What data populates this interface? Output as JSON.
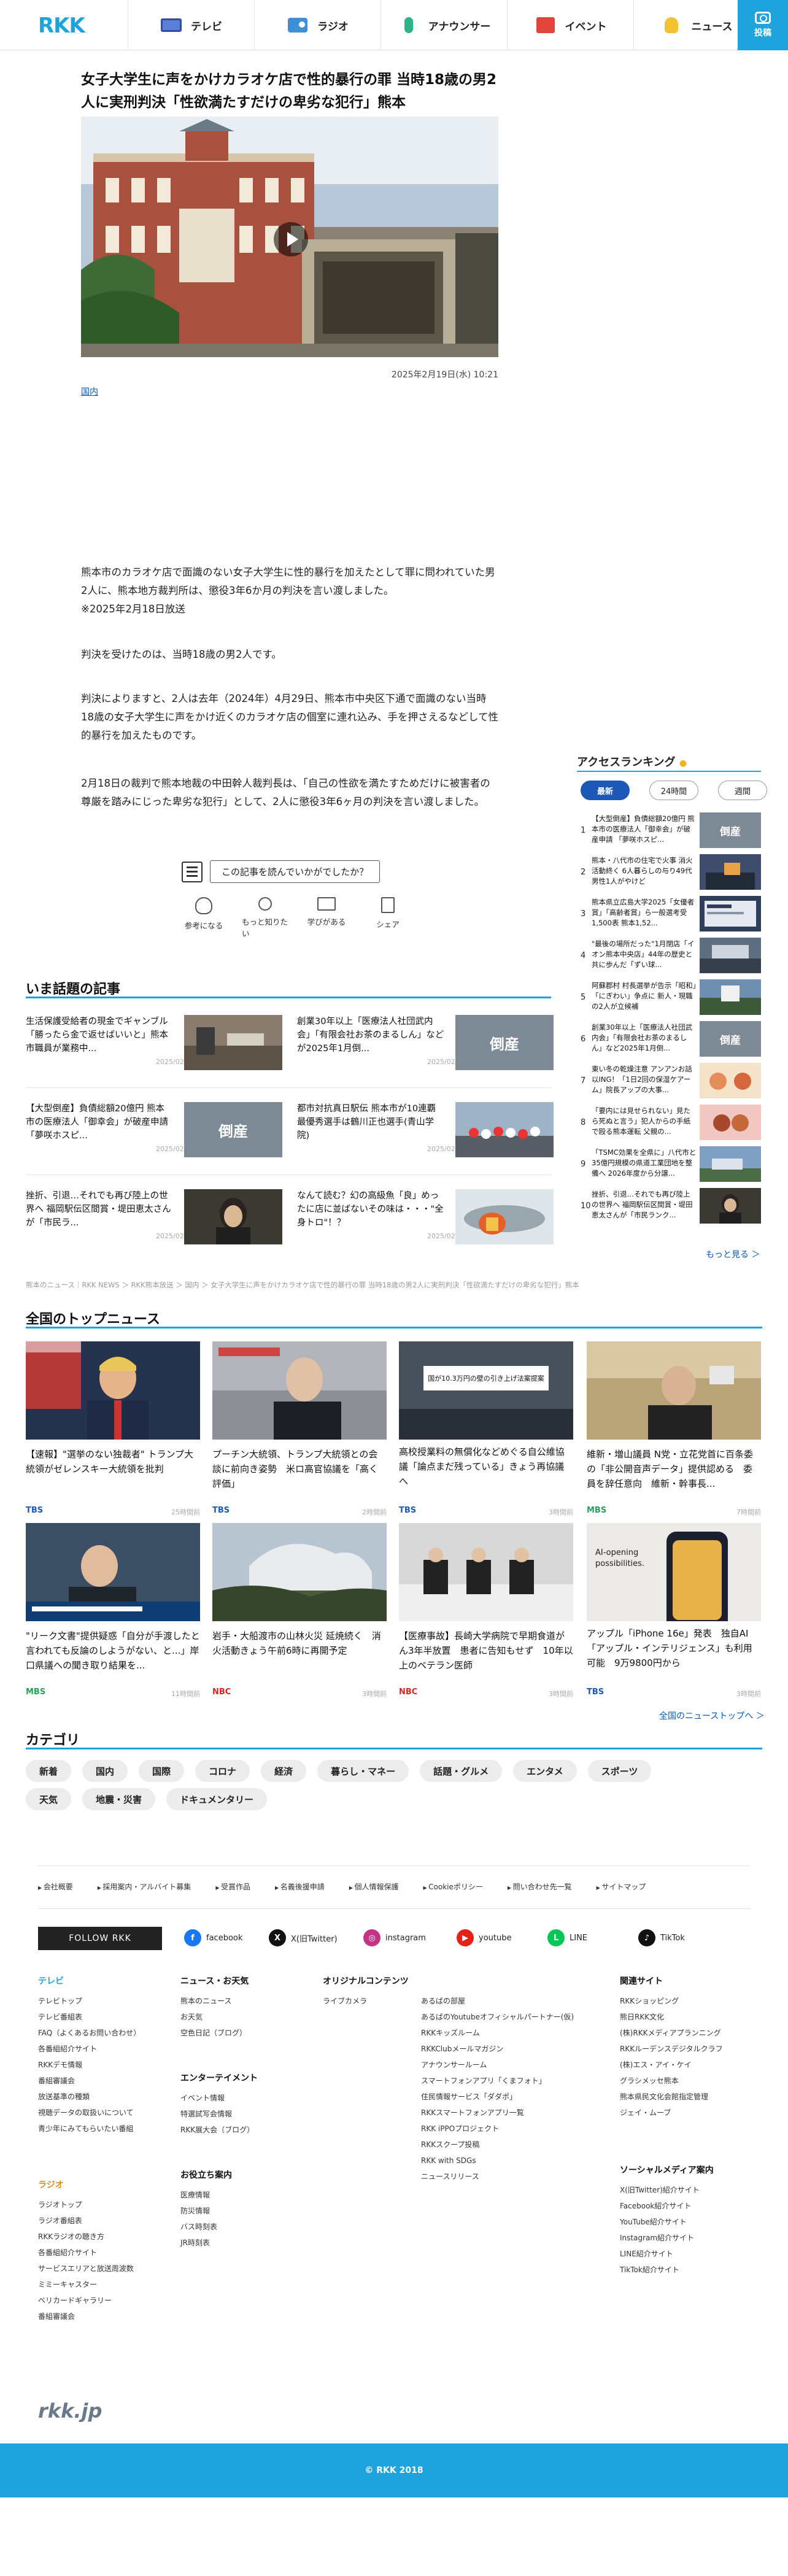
{
  "header": {
    "logo": "RKK",
    "nav": [
      {
        "label": "テレビ",
        "icon": "tv-icon"
      },
      {
        "label": "ラジオ",
        "icon": "radio-icon"
      },
      {
        "label": "アナウンサー",
        "icon": "mic-icon"
      },
      {
        "label": "イベント",
        "icon": "event-icon"
      },
      {
        "label": "ニュース",
        "icon": "bulb-icon"
      }
    ],
    "record_label": "投稿"
  },
  "article": {
    "title": "女子大学生に声をかけカラオケ店で性的暴行の罪 当時18歳の男2人に実刑判決「性欲満たすだけの卑劣な犯行」熊本",
    "date": "2025年2月19日(水) 10:21",
    "category": "国内",
    "paragraphs": [
      "熊本市のカラオケ店で面識のない女子大学生に性的暴行を加えたとして罪に問われていた男2人に、熊本地方裁判所は、懲役3年6か月の判決を言い渡しました。\n※2025年2月18日放送",
      "判決を受けたのは、当時18歳の男2人です。",
      "判決によりますと、2人は去年（2024年）4月29日、熊本市中央区下通で面識のない当時18歳の女子大学生に声をかけ近くのカラオケ店の個室に連れ込み、手を押さえるなどして性的暴行を加えたものです。",
      "2月18日の裁判で熊本地裁の中田幹人裁判長は、「自己の性欲を満たすためだけに被害者の尊厳を踏みにじった卑劣な犯行」として、2人に懲役3年6ヶ月の判決を言い渡しました。"
    ],
    "question": "この記事を読んでいかがでしたか？",
    "reactions": [
      "参考になる",
      "もっと知りたい",
      "学びがある",
      "シェア"
    ]
  },
  "popular": {
    "title": "いま話題の記事",
    "items": [
      {
        "title": "生活保護受給者の現金でギャンブル「勝ったら金で返せばいいと」熊本市職員が業務中...",
        "date": "2025/02/20"
      },
      {
        "title": "創業30年以上「医療法人社団武内会」「有限会社お茶のまるしん」などが2025年1月倒...",
        "date": "2025/02/20"
      },
      {
        "title": "【大型倒産】負債総額20億円 熊本市の医療法人「御幸会」が破産申請 「夢咲ホスピ...",
        "date": "2025/02/20"
      },
      {
        "title": "都市対抗真日駅伝 熊本市が10連覇　最優秀選手は鶴川正也選手(青山学院)",
        "date": "2025/02/20"
      },
      {
        "title": "挫折、引退…それでも再び陸上の世界へ 福岡駅伝区間賞・堤田恵太さんが「市民ラ...",
        "date": "2025/02/12"
      },
      {
        "title": "なんて読む？幻の高級魚「良」めったに店に並ばないその味は・・・\"全身トロ\"！？",
        "date": "2025/02/18"
      }
    ],
    "thumb_labels": [
      "倒産",
      "倒産"
    ]
  },
  "breadcrumb": "熊本のニュース｜RKK NEWS ＞ RKK熊本放送 ＞ 国内 ＞ 女子大学生に声をかけカラオケ店で性的暴行の罪 当時18歳の男2人に実刑判決「性欲満たすだけの卑劣な犯行」熊本",
  "ranking": {
    "title": "アクセスランキング",
    "tabs": [
      "最新",
      "24時間",
      "週間"
    ],
    "items": [
      {
        "n": "1",
        "title": "【大型倒産】負債総額20億円 熊本市の医療法人「御幸会」が破産申請 「夢咲ホスピ..."
      },
      {
        "n": "2",
        "title": "熊本・八代市の住宅で火事 消火活動終く 6人暮らしの与り49代男性1人がやけど"
      },
      {
        "n": "3",
        "title": "熊本県立広島大学2025「女優者賞」「高齢者賞」ら一般選考受1,500表 熊本1,52..."
      },
      {
        "n": "4",
        "title": "\"最後の場所だった\"1月閉店「イオン熊本中央店」44年の歴史と共に歩んだ「ずい球..."
      },
      {
        "n": "5",
        "title": "阿蘇郡村 村長選挙が告示「昭和」「にぎわい」争点に 新人・現職の2人が立候補"
      },
      {
        "n": "6",
        "title": "創業30年以上「医療法人社団武内会」「有限会社お茶のまるしん」など2025年1月倒..."
      },
      {
        "n": "7",
        "title": "東い冬の乾燥注意 アンアンお話以ING！「1日2回の保湿ケアーム」院長アップの大事..."
      },
      {
        "n": "8",
        "title": "「要内には見せられない」見たら死ぬと言う」犯人からの手紙で殴る熊本運転 父親の..."
      },
      {
        "n": "9",
        "title": "「TSMC効果を全県に」八代市と35億円規模の県道工業団地を整備へ 2026年度から分譲..."
      },
      {
        "n": "10",
        "title": "挫折、引退…それでも再び陸上の世界へ 福岡駅伝区間賞・堤田恵太さんが「市民ランク..."
      }
    ],
    "more": "もっと見る ＞",
    "thumb_labels": [
      "倒産",
      "倒産"
    ]
  },
  "national": {
    "title": "全国のトップニュース",
    "items": [
      {
        "title": "【速報】\"選挙のない独裁者\" トランプ大統領がゼレンスキー大統領を批判",
        "src": "TBS",
        "ago": "25時間前"
      },
      {
        "title": "プーチン大統領、トランプ大統領との会談に前向き姿勢　米ロ高官協議を「高く評価」",
        "src": "TBS",
        "ago": "2時間前"
      },
      {
        "title": "高校授業料の無償化などめぐる自公維協議「論点まだ残っている」きょう再協議へ",
        "src": "TBS",
        "ago": "3時間前"
      },
      {
        "title": "維新・増山議員 N党・立花党首に百条委の「非公開音声データ」提供認める　委員を辞任意向　維新・幹事長...",
        "src": "MBS",
        "ago": "7時間前"
      },
      {
        "title": "\"リーク文書\"提供疑惑「自分が手渡したと言われても反論のしようがない、と...」岸口県議への聞き取り結果を...",
        "src": "MBS",
        "ago": "11時間前"
      },
      {
        "title": "岩手・大船渡市の山林火災 延焼続く　消火活動きょう午前6時に再開予定",
        "src": "NBC",
        "ago": "3時間前"
      },
      {
        "title": "【医療事故】長崎大学病院で早期食道がん3年半放置　患者に告知もせず　10年以上のベテラン医師",
        "src": "NBC",
        "ago": "3時間前"
      },
      {
        "title": "アップル「iPhone 16e」発表　独自AI「アップル・インテリジェンス」も利用可能　9万9800円から",
        "src": "TBS",
        "ago": "3時間前"
      }
    ],
    "more": "全国のニューストップへ ＞",
    "thumb_texts": [
      "国が10.3万円の壁の引き上げ法案提案",
      "AI-opening possibilities."
    ]
  },
  "categories": {
    "title": "カテゴリ",
    "items": [
      "新着",
      "国内",
      "国際",
      "コロナ",
      "経済",
      "暮らし・マネー",
      "話題・グルメ",
      "エンタメ",
      "スポーツ",
      "天気",
      "地震・災害",
      "ドキュメンタリー"
    ]
  },
  "footer": {
    "links": [
      "会社概要",
      "採用案内・アルバイト募集",
      "受賞作品",
      "名義後援申請",
      "個人情報保護",
      "Cookieポリシー",
      "問い合わせ先一覧",
      "サイトマップ"
    ],
    "follow": "FOLLOW RKK",
    "sns": [
      {
        "label": "facebook",
        "icon": "facebook-icon",
        "color": "#1877f2"
      },
      {
        "label": "X(旧Twitter)",
        "icon": "x-icon",
        "color": "#111111"
      },
      {
        "label": "instagram",
        "icon": "instagram-icon",
        "color": "#c13584"
      },
      {
        "label": "youtube",
        "icon": "youtube-icon",
        "color": "#e62117"
      },
      {
        "label": "LINE",
        "icon": "line-icon",
        "color": "#06c755"
      },
      {
        "label": "TikTok",
        "icon": "tiktok-icon",
        "color": "#111111"
      }
    ],
    "tv": {
      "title": "テレビ",
      "items": [
        "テレビトップ",
        "テレビ番組表",
        "FAQ（よくあるお問い合わせ）",
        "各番組紹介サイト",
        "RKKデモ情報",
        "番組審議会",
        "放送基準の種類",
        "視聴データの取扱いについて",
        "青少年にみてもらいたい番組"
      ]
    },
    "radio": {
      "title": "ラジオ",
      "items": [
        "ラジオトップ",
        "ラジオ番組表",
        "RKKラジオの聴き方",
        "各番組紹介サイト",
        "サービスエリアと放送周波数",
        "ミミーキャスター",
        "ベリカードギャラリー",
        "番組審議会"
      ]
    },
    "news": {
      "title": "ニュース・お天気",
      "items": [
        "熊本のニュース",
        "お天気",
        "空色日記（ブログ）"
      ]
    },
    "ent": {
      "title": "エンターテイメント",
      "items": [
        "イベント情報",
        "特選試写会情報",
        "RKK展大会（ブログ）"
      ]
    },
    "help": {
      "title": "お役立ち案内",
      "items": [
        "医療情報",
        "防災情報",
        "バス時刻表",
        "JR時刻表"
      ]
    },
    "original": {
      "title": "オリジナルコンテンツ",
      "items": [
        "ライブカメラ"
      ]
    },
    "original2": {
      "items": [
        "あるばの部屋",
        "あるばのYoutubeオフィシャルパートナー(仮)",
        "RKKキッズルーム",
        "RKKClubメールマガジン",
        "アナウンサールーム",
        "スマートフォンアプリ「くまフォト」",
        "住民情報サービス「ダダポ」",
        "RKKスマートフォンアプリ一覧",
        "RKK iPPOプロジェクト",
        "RKKスクープ投稿",
        "RKK with SDGs",
        "ニュースリリース"
      ]
    },
    "related": {
      "title": "関連サイト",
      "items": [
        "RKKショッピング",
        "熊日RKK文化",
        "(株)RKKメディアプランニング",
        "RKKルーデンスデジタルクラフ",
        "(株)エス・アイ・ケイ",
        "グラシメッセ熊本",
        "熊本県民文化会館指定管理",
        "ジェイ・ムーブ"
      ]
    },
    "social": {
      "title": "ソーシャルメディア案内",
      "items": [
        "X(旧Twitter)紹介サイト",
        "Facebook紹介サイト",
        "YouTube紹介サイト",
        "Instagram紹介サイト",
        "LINE紹介サイト",
        "TikTok紹介サイト"
      ]
    },
    "logo": "rkk.jp",
    "copyright": "© RKK 2018"
  }
}
